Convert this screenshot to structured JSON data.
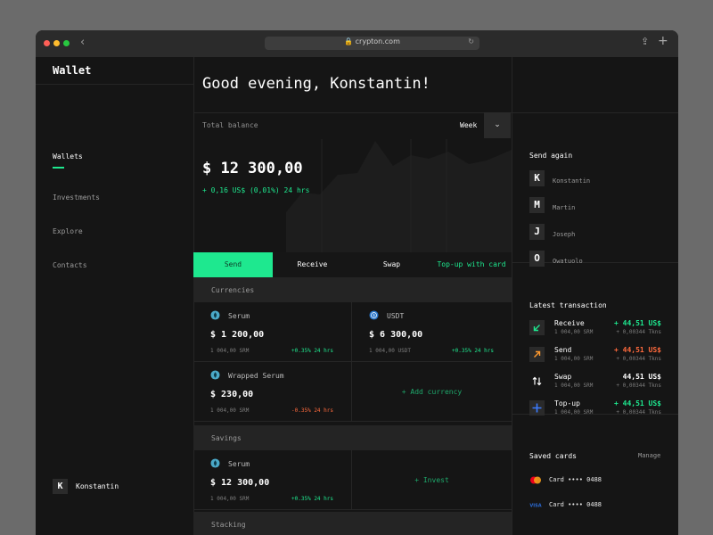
{
  "browser": {
    "url": "crypton.com"
  },
  "sidebar": {
    "brand": "Wallet",
    "nav": [
      "Wallets",
      "Investments",
      "Explore",
      "Contacts"
    ],
    "user": {
      "initial": "K",
      "name": "Konstantin"
    }
  },
  "main": {
    "greeting": "Good evening, Konstantin!",
    "balance": {
      "label": "Total balance",
      "period": "Week",
      "value": "$ 12 300,00",
      "change": "+ 0,16 US$ (0,01%) 24 hrs"
    },
    "actions": [
      "Send",
      "Receive",
      "Swap",
      "Top-up with card"
    ],
    "currencies": {
      "label": "Currencies",
      "items": [
        {
          "name": "Serum",
          "amount": "$ 1 200,00",
          "sub": "1 004,00 SRM",
          "change": "+0.35% 24 hrs",
          "trend": "up",
          "icon": "serum-icon"
        },
        {
          "name": "USDT",
          "amount": "$ 6 300,00",
          "sub": "1 004,00 USDT",
          "change": "+0.35% 24 hrs",
          "trend": "up",
          "icon": "usdt-icon"
        },
        {
          "name": "Wrapped Serum",
          "amount": "$ 230,00",
          "sub": "1 004,00 SRM",
          "change": "-0.35% 24 hrs",
          "trend": "down",
          "icon": "serum-icon"
        }
      ],
      "add_label": "+ Add currency"
    },
    "savings": {
      "label": "Savings",
      "item": {
        "name": "Serum",
        "amount": "$ 12 300,00",
        "sub": "1 004,00 SRM",
        "change": "+0.35% 24 hrs"
      },
      "invest_label": "+ Invest"
    },
    "stacking": {
      "label": "Stacking"
    }
  },
  "right": {
    "send_again": {
      "title": "Send again",
      "contacts": [
        {
          "initial": "K",
          "name": "Konstantin"
        },
        {
          "initial": "M",
          "name": "Martin"
        },
        {
          "initial": "J",
          "name": "Joseph"
        },
        {
          "initial": "O",
          "name": "Owatuolo"
        }
      ]
    },
    "transactions": {
      "title": "Latest transaction",
      "items": [
        {
          "type": "Receive",
          "sub": "1 004,00 SRM",
          "amount": "+ 44,51 US$",
          "amount2": "+ 0,00344 Tkns",
          "color": "#1ee88f",
          "icon": "arrow-down-left-icon"
        },
        {
          "type": "Send",
          "sub": "1 004,00 SRM",
          "amount": "+ 44,51 US$",
          "amount2": "+ 0,00344 Tkns",
          "color": "#ff6a3d",
          "icon": "arrow-up-right-icon"
        },
        {
          "type": "Swap",
          "sub": "1 004,00 SRM",
          "amount": "44,51 US$",
          "amount2": "+ 0,00344 Tkns",
          "color": "#ffffff",
          "icon": "swap-icon"
        },
        {
          "type": "Top-up",
          "sub": "1 004,00 SRM",
          "amount": "+ 44,51 US$",
          "amount2": "+ 0,00344 Tkns",
          "color": "#1ee88f",
          "icon": "plus-icon"
        }
      ]
    },
    "saved_cards": {
      "title": "Saved cards",
      "manage": "Manage",
      "cards": [
        {
          "label": "Card •••• 0488",
          "brand": "mastercard-icon"
        },
        {
          "label": "Card •••• 0488",
          "brand": "visa-icon"
        }
      ]
    }
  },
  "colors": {
    "accent": "#1ee88f",
    "negative": "#ff6a3d",
    "background": "#151515"
  }
}
